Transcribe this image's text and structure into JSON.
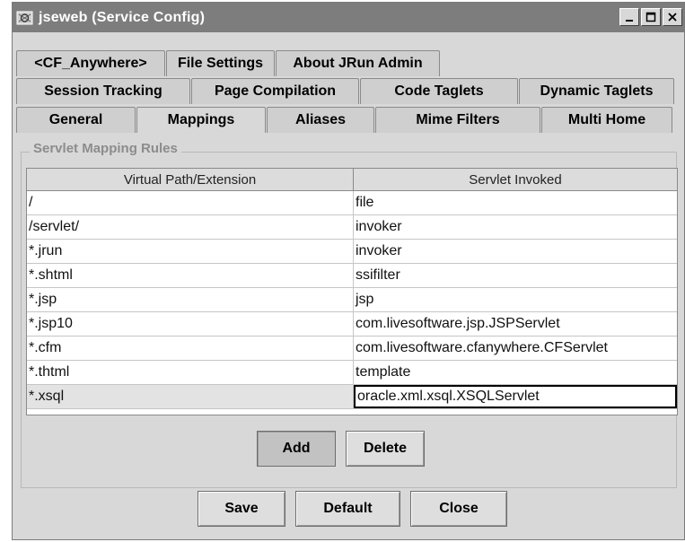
{
  "window": {
    "title": "jseweb (Service Config)",
    "controls": [
      "minimize-icon",
      "maximize-icon",
      "close-icon"
    ]
  },
  "tabs": {
    "row1": [
      "<CF_Anywhere>",
      "File Settings",
      "About JRun Admin"
    ],
    "row2": [
      "Session Tracking",
      "Page Compilation",
      "Code Taglets",
      "Dynamic Taglets"
    ],
    "row3": [
      "General",
      "Mappings",
      "Aliases",
      "Mime Filters",
      "Multi Home"
    ],
    "active": "Mappings"
  },
  "group": {
    "title": "Servlet Mapping Rules"
  },
  "table": {
    "headers": [
      "Virtual Path/Extension",
      "Servlet Invoked"
    ],
    "rows": [
      [
        "/",
        "file"
      ],
      [
        "/servlet/",
        "invoker"
      ],
      [
        "*.jrun",
        "invoker"
      ],
      [
        "*.shtml",
        "ssifilter"
      ],
      [
        "*.jsp",
        "jsp"
      ],
      [
        "*.jsp10",
        "com.livesoftware.jsp.JSPServlet"
      ],
      [
        "*.cfm",
        "com.livesoftware.cfanywhere.CFServlet"
      ],
      [
        "*.thtml",
        "template"
      ],
      [
        "*.xsql",
        "oracle.xml.xsql.XSQLServlet"
      ]
    ],
    "selected_row": 8
  },
  "buttons": {
    "add": "Add",
    "delete": "Delete",
    "save": "Save",
    "default": "Default",
    "close": "Close"
  },
  "colors": {
    "titlebar": "#7d7d7d",
    "window_bg": "#d8d8d8",
    "group_title": "#8c8c8c"
  }
}
